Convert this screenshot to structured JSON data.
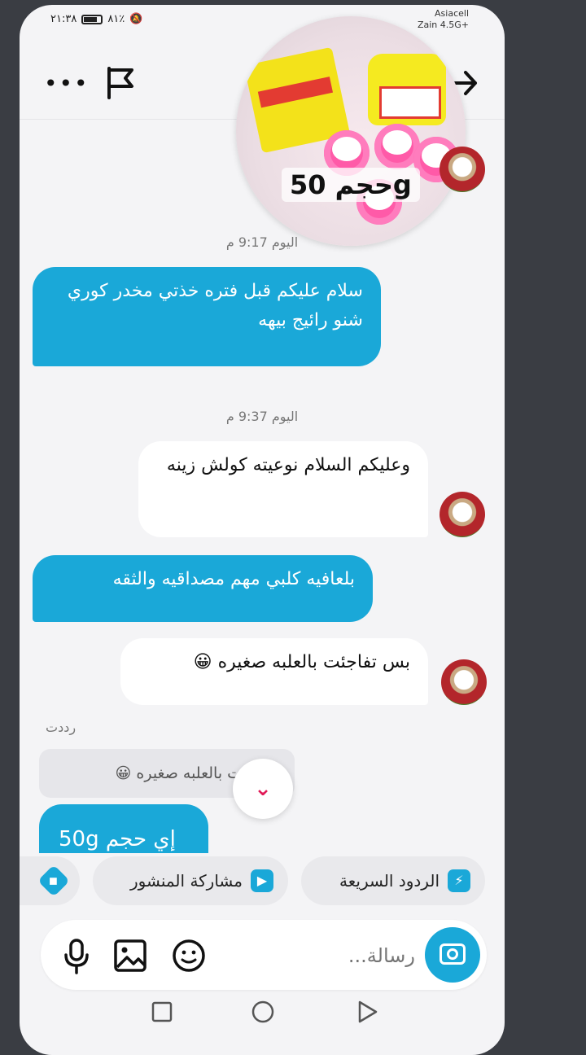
{
  "status_bar": {
    "time": "٢١:٣٨",
    "battery": "٨١٪",
    "carrier_top": "Asiacell",
    "carrier_bottom": "Zain 4.5G+",
    "signal_value": "36"
  },
  "header": {
    "post_overlay_label": "حجم 50g"
  },
  "messages": {
    "timestamp_1": "اليوم 9:17 م",
    "msg_1": "سلام عليكم قبل فتره خذتي مخدر كوري شنو رائيج بيهه",
    "timestamp_2": "اليوم 9:37 م",
    "msg_2": "وعليكم السلام نوعيته كولش زينه",
    "msg_3": "بلعافيه كلبي مهم مصداقيه والثقه",
    "msg_4": "بس تفاجئت بالعلبه صغيره 😀",
    "reply_label": "رددت",
    "reply_quote": "تفاجئت بالعلبه صغيره 😀",
    "partial_reply": "إي حجم 50g"
  },
  "quick_actions": {
    "quick_replies": "الردود السريعة",
    "share_post": "مشاركة المنشور"
  },
  "composer": {
    "placeholder": "رسالة..."
  },
  "colors": {
    "accent": "#1aa8d8",
    "background": "#f4f4f6",
    "scroll_arrow": "#e11a57"
  },
  "icons": {
    "more": "more-icon",
    "flag": "flag-icon",
    "back": "arrow-right-icon",
    "scroll_down": "chevrons-down-icon",
    "camera": "camera-icon",
    "mic": "mic-icon",
    "gallery": "image-icon",
    "sticker": "sticker-icon",
    "quick_reply": "lightning-icon",
    "share": "play-icon",
    "tag": "tag-icon"
  }
}
